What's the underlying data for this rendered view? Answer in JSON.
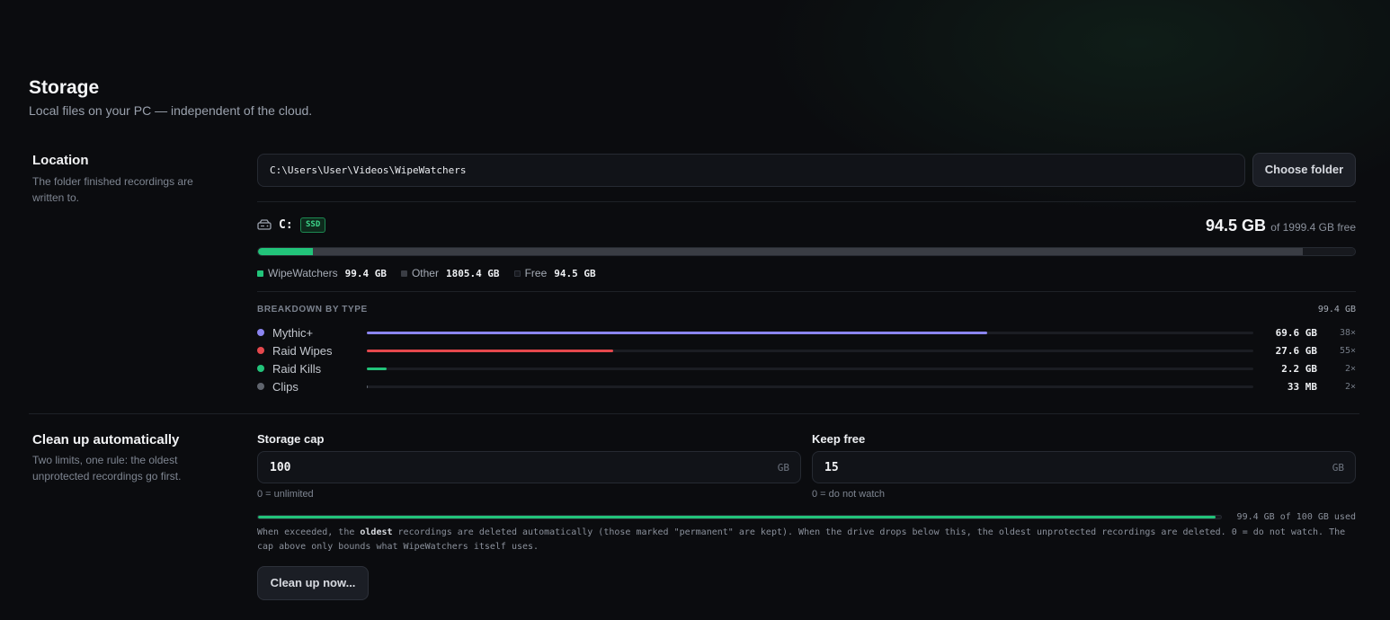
{
  "header": {
    "title": "Storage",
    "subtitle": "Local files on your PC — independent of the cloud."
  },
  "location": {
    "title": "Location",
    "description": "The folder finished recordings are written to.",
    "path": "C:\\Users\\User\\Videos\\WipeWatchers",
    "choose_label": "Choose folder"
  },
  "drive": {
    "letter": "C:",
    "type_badge": "SSD",
    "free_value": "94.5 GB",
    "free_of": "of 1999.4 GB free",
    "total_gb": 1999.4,
    "segments": [
      {
        "label": "WipeWatchers",
        "value": "99.4 GB",
        "gb": 99.4,
        "color": "#22c47a"
      },
      {
        "label": "Other",
        "value": "1805.4 GB",
        "gb": 1805.4,
        "color": "#3a3d44"
      },
      {
        "label": "Free",
        "value": "94.5 GB",
        "gb": 94.5,
        "color": "#17191e"
      }
    ],
    "icon": "hard-drive-icon"
  },
  "breakdown": {
    "header": "BREAKDOWN BY TYPE",
    "total": "99.4 GB",
    "max_gb": 99.4,
    "items": [
      {
        "label": "Mythic+",
        "size": "69.6 GB",
        "count": "38×",
        "gb": 69.6,
        "color": "#8b85f0"
      },
      {
        "label": "Raid Wipes",
        "size": "27.6 GB",
        "count": "55×",
        "gb": 27.6,
        "color": "#e5484d"
      },
      {
        "label": "Raid Kills",
        "size": "2.2 GB",
        "count": "2×",
        "gb": 2.2,
        "color": "#22c47a"
      },
      {
        "label": "Clips",
        "size": "33 MB",
        "count": "2×",
        "gb": 0.033,
        "color": "#5f646d"
      }
    ]
  },
  "cleanup": {
    "title": "Clean up automatically",
    "description": "Two limits, one rule: the oldest unprotected recordings go first.",
    "storage_cap": {
      "label": "Storage cap",
      "value": "100",
      "unit": "GB",
      "hint": "0 = unlimited"
    },
    "keep_free": {
      "label": "Keep free",
      "value": "15",
      "unit": "GB",
      "hint": "0 = do not watch"
    },
    "used_fraction": 0.994,
    "used_text": "99.4 GB of 100 GB used",
    "explain_before": "When exceeded, the ",
    "explain_bold": "oldest",
    "explain_after": " recordings are deleted automatically (those marked \"permanent\" are kept). When the drive drops below this, the oldest unprotected recordings are deleted. 0 = do not watch. The cap above only bounds what WipeWatchers itself uses.",
    "button_label": "Clean up now..."
  }
}
